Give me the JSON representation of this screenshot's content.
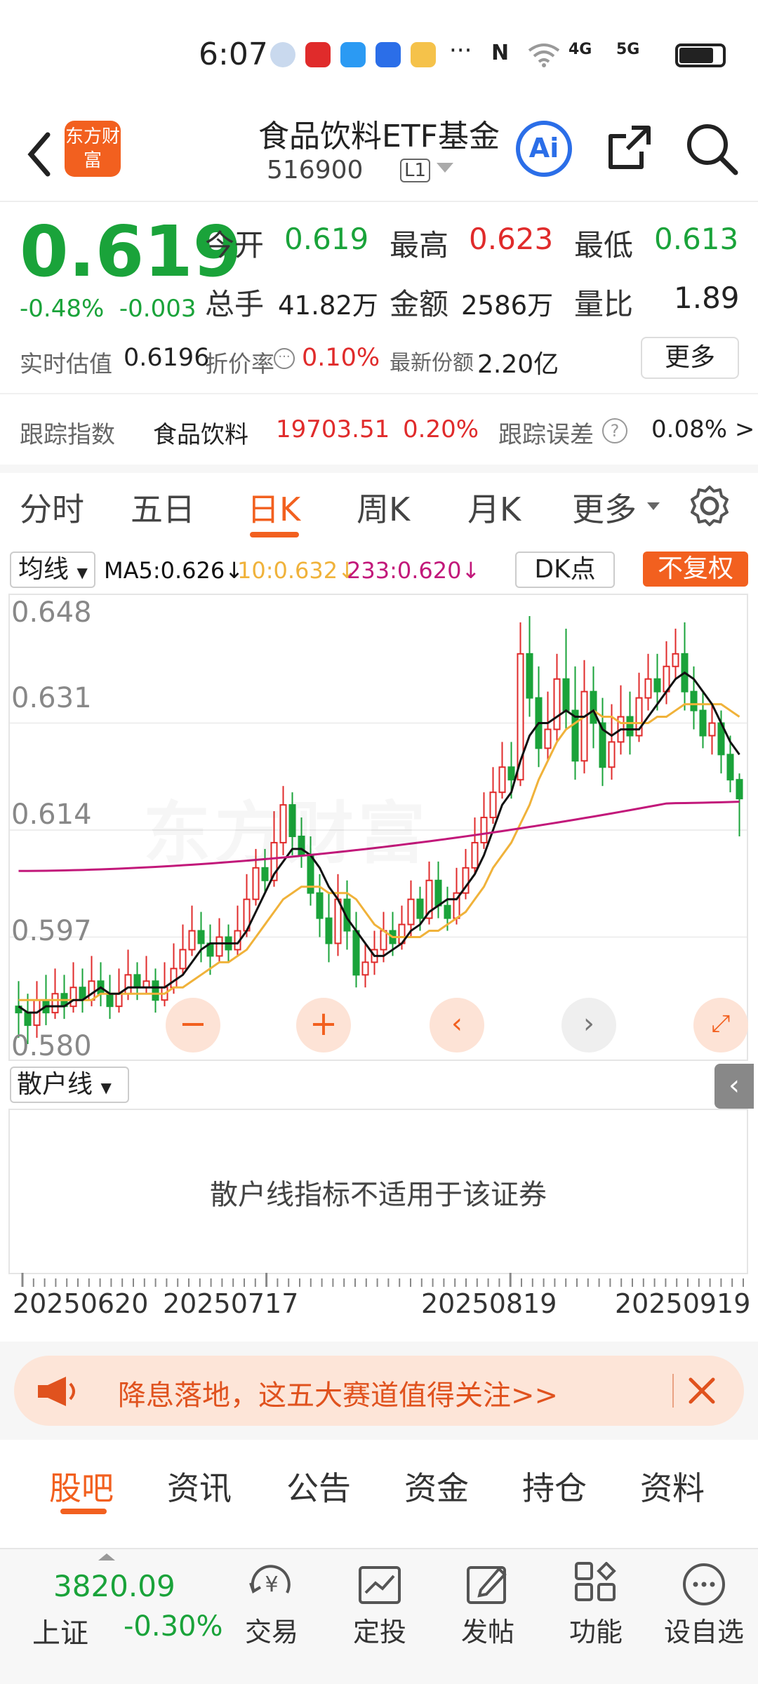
{
  "status": {
    "time": "6:07",
    "net1": "4G",
    "net2": "5G",
    "more": "···"
  },
  "header": {
    "title": "食品饮料ETF基金",
    "code": "516900",
    "level": "L1",
    "logo": "东方财富",
    "ai": "Ai"
  },
  "quote": {
    "price": "0.619",
    "pct": "-0.48%",
    "chg": "-0.003",
    "open_label": "今开",
    "open": "0.619",
    "high_label": "最高",
    "high": "0.623",
    "low_label": "最低",
    "low": "0.613",
    "vol_label": "总手",
    "vol": "41.82万",
    "amt_label": "金额",
    "amt": "2586万",
    "ratio_label": "量比",
    "ratio": "1.89",
    "est_label": "实时估值",
    "est": "0.6196",
    "disc_label": "折价率",
    "disc": "0.10%",
    "share_label": "最新份额",
    "share": "2.20亿",
    "more": "更多"
  },
  "tracking": {
    "label": "跟踪指数",
    "name": "食品饮料",
    "value": "19703.51",
    "pct": "0.20%",
    "err_label": "跟踪误差",
    "err": "0.08% >"
  },
  "period_tabs": [
    "分时",
    "五日",
    "日K",
    "周K",
    "月K",
    "更多"
  ],
  "ma": {
    "selector": "均线",
    "ma5": "MA5:0.626↓",
    "ma10": "10:0.632↓",
    "ma233": "233:0.620↓",
    "dk": "DK点",
    "adjust": "不复权"
  },
  "chart_data": {
    "type": "candlestick",
    "yticks": [
      "0.648",
      "0.631",
      "0.614",
      "0.597",
      "0.580"
    ],
    "ylim": [
      0.58,
      0.648
    ],
    "xticks": [
      "20250620",
      "20250717",
      "20250819",
      "20250919"
    ],
    "candles": [
      [
        0.586,
        0.585,
        0.59,
        0.581
      ],
      [
        0.585,
        0.583,
        0.588,
        0.58
      ],
      [
        0.583,
        0.587,
        0.59,
        0.581
      ],
      [
        0.587,
        0.585,
        0.591,
        0.583
      ],
      [
        0.585,
        0.588,
        0.592,
        0.584
      ],
      [
        0.588,
        0.586,
        0.591,
        0.584
      ],
      [
        0.586,
        0.589,
        0.593,
        0.585
      ],
      [
        0.589,
        0.587,
        0.592,
        0.585
      ],
      [
        0.587,
        0.59,
        0.594,
        0.586
      ],
      [
        0.59,
        0.588,
        0.593,
        0.586
      ],
      [
        0.588,
        0.586,
        0.591,
        0.584
      ],
      [
        0.586,
        0.588,
        0.592,
        0.585
      ],
      [
        0.588,
        0.591,
        0.595,
        0.587
      ],
      [
        0.591,
        0.589,
        0.593,
        0.587
      ],
      [
        0.589,
        0.59,
        0.594,
        0.588
      ],
      [
        0.59,
        0.587,
        0.592,
        0.585
      ],
      [
        0.587,
        0.589,
        0.593,
        0.586
      ],
      [
        0.589,
        0.592,
        0.596,
        0.588
      ],
      [
        0.592,
        0.595,
        0.599,
        0.591
      ],
      [
        0.595,
        0.598,
        0.602,
        0.594
      ],
      [
        0.598,
        0.596,
        0.601,
        0.593
      ],
      [
        0.596,
        0.594,
        0.599,
        0.591
      ],
      [
        0.594,
        0.597,
        0.6,
        0.593
      ],
      [
        0.597,
        0.595,
        0.599,
        0.593
      ],
      [
        0.595,
        0.598,
        0.602,
        0.594
      ],
      [
        0.598,
        0.603,
        0.607,
        0.597
      ],
      [
        0.603,
        0.608,
        0.611,
        0.602
      ],
      [
        0.608,
        0.606,
        0.611,
        0.604
      ],
      [
        0.606,
        0.612,
        0.617,
        0.605
      ],
      [
        0.612,
        0.618,
        0.621,
        0.61
      ],
      [
        0.618,
        0.613,
        0.62,
        0.61
      ],
      [
        0.613,
        0.61,
        0.616,
        0.608
      ],
      [
        0.61,
        0.604,
        0.613,
        0.602
      ],
      [
        0.604,
        0.6,
        0.607,
        0.597
      ],
      [
        0.6,
        0.596,
        0.604,
        0.593
      ],
      [
        0.596,
        0.603,
        0.607,
        0.594
      ],
      [
        0.603,
        0.598,
        0.606,
        0.595
      ],
      [
        0.598,
        0.591,
        0.601,
        0.589
      ],
      [
        0.591,
        0.593,
        0.596,
        0.589
      ],
      [
        0.593,
        0.595,
        0.598,
        0.591
      ],
      [
        0.595,
        0.598,
        0.601,
        0.593
      ],
      [
        0.598,
        0.596,
        0.601,
        0.594
      ],
      [
        0.596,
        0.599,
        0.602,
        0.595
      ],
      [
        0.599,
        0.603,
        0.606,
        0.597
      ],
      [
        0.603,
        0.6,
        0.605,
        0.598
      ],
      [
        0.6,
        0.606,
        0.609,
        0.599
      ],
      [
        0.606,
        0.602,
        0.609,
        0.6
      ],
      [
        0.602,
        0.6,
        0.605,
        0.598
      ],
      [
        0.6,
        0.604,
        0.608,
        0.599
      ],
      [
        0.604,
        0.608,
        0.611,
        0.603
      ],
      [
        0.608,
        0.612,
        0.616,
        0.607
      ],
      [
        0.612,
        0.616,
        0.62,
        0.611
      ],
      [
        0.616,
        0.62,
        0.624,
        0.615
      ],
      [
        0.62,
        0.624,
        0.628,
        0.619
      ],
      [
        0.624,
        0.622,
        0.628,
        0.619
      ],
      [
        0.622,
        0.642,
        0.647,
        0.621
      ],
      [
        0.642,
        0.635,
        0.648,
        0.632
      ],
      [
        0.635,
        0.627,
        0.64,
        0.624
      ],
      [
        0.627,
        0.63,
        0.636,
        0.625
      ],
      [
        0.63,
        0.638,
        0.642,
        0.628
      ],
      [
        0.638,
        0.633,
        0.646,
        0.63
      ],
      [
        0.633,
        0.625,
        0.64,
        0.622
      ],
      [
        0.625,
        0.636,
        0.641,
        0.623
      ],
      [
        0.636,
        0.631,
        0.64,
        0.627
      ],
      [
        0.631,
        0.624,
        0.635,
        0.621
      ],
      [
        0.624,
        0.628,
        0.634,
        0.622
      ],
      [
        0.628,
        0.632,
        0.637,
        0.626
      ],
      [
        0.632,
        0.629,
        0.636,
        0.626
      ],
      [
        0.629,
        0.635,
        0.639,
        0.628
      ],
      [
        0.635,
        0.638,
        0.642,
        0.633
      ],
      [
        0.638,
        0.636,
        0.642,
        0.633
      ],
      [
        0.636,
        0.64,
        0.644,
        0.634
      ],
      [
        0.64,
        0.642,
        0.646,
        0.638
      ],
      [
        0.642,
        0.636,
        0.647,
        0.633
      ],
      [
        0.636,
        0.633,
        0.64,
        0.63
      ],
      [
        0.633,
        0.629,
        0.636,
        0.627
      ],
      [
        0.629,
        0.631,
        0.634,
        0.626
      ],
      [
        0.631,
        0.626,
        0.633,
        0.623
      ],
      [
        0.626,
        0.622,
        0.629,
        0.62
      ],
      [
        0.622,
        0.619,
        0.623,
        0.613
      ]
    ],
    "ma5": [
      0.586,
      0.585,
      0.585,
      0.586,
      0.586,
      0.586,
      0.587,
      0.587,
      0.588,
      0.589,
      0.588,
      0.588,
      0.589,
      0.589,
      0.589,
      0.589,
      0.589,
      0.59,
      0.591,
      0.593,
      0.595,
      0.596,
      0.596,
      0.596,
      0.596,
      0.598,
      0.601,
      0.604,
      0.607,
      0.609,
      0.611,
      0.611,
      0.61,
      0.608,
      0.605,
      0.603,
      0.6,
      0.598,
      0.596,
      0.594,
      0.594,
      0.595,
      0.596,
      0.598,
      0.599,
      0.601,
      0.602,
      0.603,
      0.603,
      0.605,
      0.607,
      0.61,
      0.614,
      0.618,
      0.62,
      0.625,
      0.629,
      0.631,
      0.631,
      0.632,
      0.633,
      0.632,
      0.632,
      0.633,
      0.63,
      0.629,
      0.63,
      0.63,
      0.63,
      0.632,
      0.634,
      0.636,
      0.638,
      0.639,
      0.638,
      0.636,
      0.634,
      0.631,
      0.628,
      0.626
    ],
    "ma10": [
      0.587,
      0.587,
      0.587,
      0.587,
      0.587,
      0.587,
      0.587,
      0.587,
      0.587,
      0.588,
      0.588,
      0.588,
      0.588,
      0.588,
      0.588,
      0.588,
      0.588,
      0.589,
      0.589,
      0.59,
      0.591,
      0.592,
      0.593,
      0.593,
      0.594,
      0.595,
      0.597,
      0.599,
      0.601,
      0.603,
      0.604,
      0.605,
      0.605,
      0.605,
      0.604,
      0.604,
      0.604,
      0.603,
      0.601,
      0.599,
      0.598,
      0.597,
      0.597,
      0.597,
      0.597,
      0.598,
      0.598,
      0.599,
      0.6,
      0.601,
      0.603,
      0.605,
      0.608,
      0.61,
      0.612,
      0.615,
      0.618,
      0.622,
      0.625,
      0.628,
      0.63,
      0.631,
      0.632,
      0.633,
      0.632,
      0.632,
      0.631,
      0.631,
      0.631,
      0.631,
      0.632,
      0.632,
      0.633,
      0.634,
      0.634,
      0.634,
      0.634,
      0.634,
      0.633,
      0.632
    ],
    "ma233_range": [
      0.6075,
      0.6205
    ]
  },
  "retail": {
    "selector": "散户线",
    "message": "散户线指标不适用于该证券"
  },
  "banner": {
    "text": "降息落地，这五大赛道值得关注>>"
  },
  "news_tabs": [
    "股吧",
    "资讯",
    "公告",
    "资金",
    "持仓",
    "资料"
  ],
  "bottom": {
    "index_value": "3820.09",
    "index_name": "上证",
    "index_pct": "-0.30%",
    "items": [
      "交易",
      "定投",
      "发帖",
      "功能",
      "设自选"
    ]
  },
  "colors": {
    "up": "#e02b2b",
    "down": "#1aa33a",
    "accent": "#f2601f",
    "ma5": "#111111",
    "ma10": "#f0b23a",
    "ma233": "#c2187a"
  }
}
